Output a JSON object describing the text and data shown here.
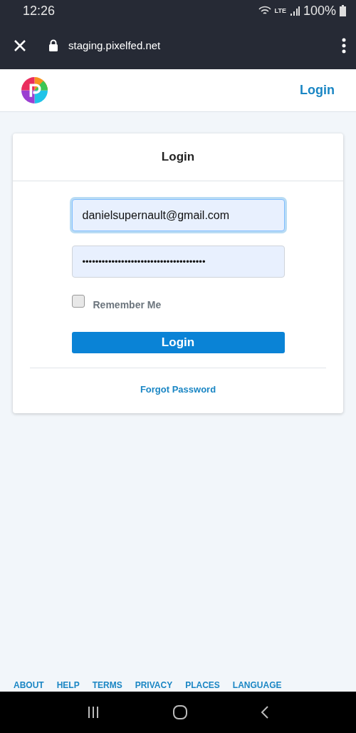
{
  "status_bar": {
    "time": "12:26",
    "network": "LTE",
    "battery": "100%"
  },
  "browser_bar": {
    "url": "staging.pixelfed.net"
  },
  "header": {
    "login_link": "Login"
  },
  "card": {
    "title": "Login",
    "email_field": {
      "value": "danielsupernault@gmail.com",
      "focused": true
    },
    "password_field": {
      "value": "••••••••••••••••••••••••••••••••••••••"
    },
    "remember": {
      "label": "Remember Me",
      "checked": false
    },
    "submit": "Login",
    "forgot": "Forgot Password"
  },
  "footer_links": [
    "ABOUT",
    "HELP",
    "TERMS",
    "PRIVACY",
    "PLACES",
    "LANGUAGE"
  ]
}
